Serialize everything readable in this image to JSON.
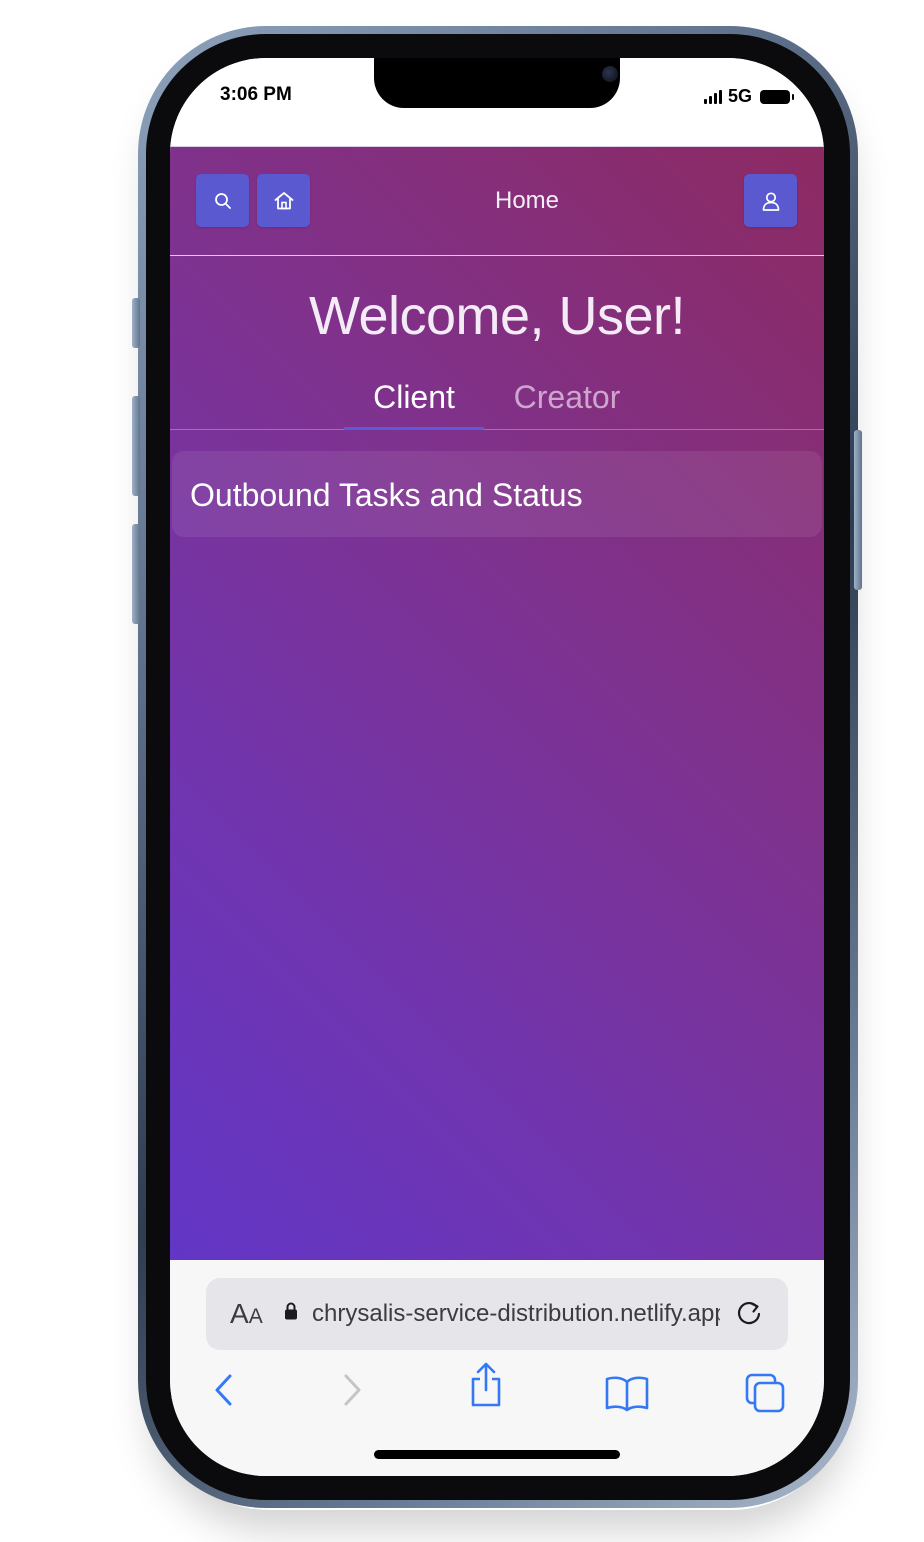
{
  "status_bar": {
    "time": "3:06 PM",
    "network": "5G"
  },
  "nav": {
    "title": "Home",
    "search_icon": "search-icon",
    "home_icon": "home-icon",
    "profile_icon": "user-icon"
  },
  "main": {
    "welcome": "Welcome, User!",
    "tabs": [
      {
        "label": "Client",
        "selected": true
      },
      {
        "label": "Creator",
        "selected": false
      }
    ],
    "section_title": "Outbound Tasks and Status"
  },
  "browser": {
    "reader_label": "AA",
    "url": "chrysalis-service-distribution.netlify.app",
    "toolbar_icons": [
      "back-icon",
      "forward-icon",
      "share-icon",
      "bookmarks-icon",
      "tabs-icon"
    ]
  },
  "colors": {
    "gradient_start": "#6236c6",
    "gradient_end": "#8d2a62",
    "button_bg": "#5a59cf",
    "tab_underline": "#5c5ad8",
    "safari_blue": "#3478f6"
  }
}
